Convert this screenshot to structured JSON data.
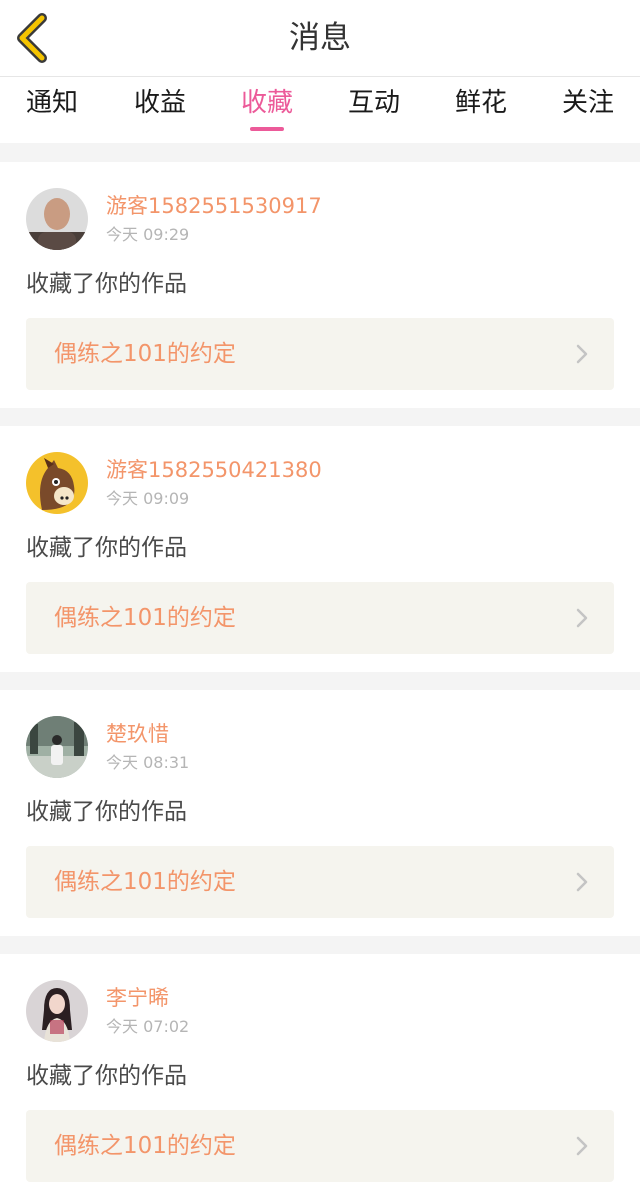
{
  "header": {
    "title": "消息",
    "back_icon": "chevron-left-icon",
    "accent": "#f5c400"
  },
  "tabs": [
    {
      "label": "通知",
      "active": false
    },
    {
      "label": "收益",
      "active": false
    },
    {
      "label": "收藏",
      "active": true
    },
    {
      "label": "互动",
      "active": false
    },
    {
      "label": "鲜花",
      "active": false
    },
    {
      "label": "关注",
      "active": false
    }
  ],
  "colors": {
    "active_tab": "#ec5a99",
    "username": "#f3956a",
    "card_link_bg": "#f5f4ee"
  },
  "messages": [
    {
      "username": "游客1582551530917",
      "time": "今天 09:29",
      "action": "收藏了你的作品",
      "work_title": "偶练之101的约定",
      "avatar": "man-photo-avatar"
    },
    {
      "username": "游客1582550421380",
      "time": "今天 09:09",
      "action": "收藏了你的作品",
      "work_title": "偶练之101的约定",
      "avatar": "horse-cartoon-avatar"
    },
    {
      "username": "楚玖惜",
      "time": "今天 08:31",
      "action": "收藏了你的作品",
      "work_title": "偶练之101的约定",
      "avatar": "street-photo-avatar"
    },
    {
      "username": "李宁晞",
      "time": "今天 07:02",
      "action": "收藏了你的作品",
      "work_title": "偶练之101的约定",
      "avatar": "girl-photo-avatar"
    }
  ]
}
